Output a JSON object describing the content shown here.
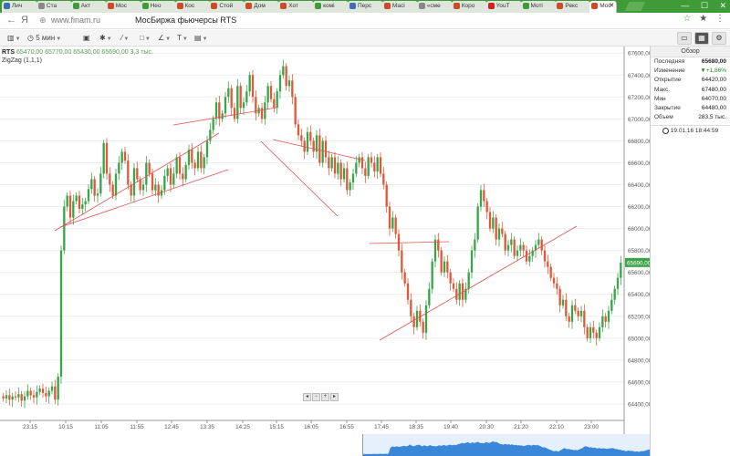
{
  "browser": {
    "tabs": [
      {
        "label": "Лич",
        "icon_color": "#3d6fb4"
      },
      {
        "label": "Ста",
        "icon_color": "#888888"
      },
      {
        "label": "Акт",
        "icon_color": "#3f9a38"
      },
      {
        "label": "Мос",
        "icon_color": "#d04a2a"
      },
      {
        "label": "Нео",
        "icon_color": "#3f9a38"
      },
      {
        "label": "Кос",
        "icon_color": "#d04a2a"
      },
      {
        "label": "Стой",
        "icon_color": "#d04a2a"
      },
      {
        "label": "Дом",
        "icon_color": "#d04a2a"
      },
      {
        "label": "Хот",
        "icon_color": "#d04a2a"
      },
      {
        "label": "комі",
        "icon_color": "#3f9a38"
      },
      {
        "label": "Перс",
        "icon_color": "#3d6fb4"
      },
      {
        "label": "Масі",
        "icon_color": "#d04a2a"
      },
      {
        "label": "«сме",
        "icon_color": "#888888"
      },
      {
        "label": "Коро",
        "icon_color": "#d04a2a"
      },
      {
        "label": "YouT",
        "icon_color": "#d02020"
      },
      {
        "label": "Моті",
        "icon_color": "#3f9a38"
      },
      {
        "label": "Рекс",
        "icon_color": "#d04a2a"
      },
      {
        "label": "Мос",
        "icon_color": "#d04a2a",
        "active": true
      }
    ],
    "window_controls": [
      "—",
      "☐",
      "✕"
    ],
    "back_icon": "←",
    "forward_icon": "Я",
    "url": "www.finam.ru",
    "page_title": "МосБиржа фьючерсы RTS",
    "addr_icons": [
      "☆",
      "★",
      "⋮"
    ]
  },
  "toolbar": {
    "interval": "5 мин",
    "items": [
      "chart-type",
      "interval",
      "save",
      "indicators",
      "draw",
      "shapes",
      "lines",
      "text",
      "image"
    ]
  },
  "legend": {
    "symbol": "RTS",
    "ohlc": "65470,00  65770,00  65430,00  65690,00  3,3 тыс.",
    "indicator": "ZigZag (1,1,1)"
  },
  "chart_data": {
    "type": "candlestick",
    "symbol": "RTS",
    "y_ticks": [
      64400,
      64600,
      64800,
      65000,
      65200,
      65400,
      65600,
      65800,
      66000,
      66200,
      66400,
      66600,
      66800,
      67000,
      67200,
      67400,
      67600
    ],
    "y_tick_labels": [
      "64400,00",
      "64600,00",
      "64800,00",
      "65000,00",
      "65200,00",
      "65400,00",
      "65600,00",
      "65800,00",
      "66000,00",
      "66200,00",
      "66400,00",
      "66600,00",
      "66800,00",
      "67000,00",
      "67200,00",
      "67400,00",
      "67600,00"
    ],
    "ylim": [
      64250,
      67660
    ],
    "x_labels": [
      "23:15",
      "10:15",
      "11:05",
      "11:55",
      "12:45",
      "13:35",
      "14:25",
      "15:15",
      "16:05",
      "16:55",
      "17:45",
      "18:35",
      "19:40",
      "20:30",
      "21:20",
      "22:10",
      "23:00"
    ],
    "last_price": "65690,00",
    "up_color": "#3aa54a",
    "down_color": "#e05a3a",
    "line_color": "#e05050",
    "closes": [
      64450,
      64480,
      64440,
      64470,
      64460,
      64490,
      64430,
      64470,
      64520,
      64480,
      64460,
      64510,
      64540,
      64500,
      64470,
      64520,
      64560,
      64440,
      64650,
      65800,
      66200,
      66300,
      66100,
      66250,
      66300,
      66180,
      66220,
      66250,
      66360,
      66450,
      66300,
      66320,
      66500,
      66780,
      66500,
      66400,
      66300,
      66500,
      66600,
      66700,
      66620,
      66400,
      66300,
      66550,
      66450,
      66350,
      66400,
      66600,
      66500,
      66350,
      66400,
      66300,
      66350,
      66480,
      66550,
      66400,
      66500,
      66650,
      66500,
      66450,
      66580,
      66720,
      66600,
      66550,
      66700,
      66550,
      66650,
      66800,
      66900,
      67000,
      67150,
      67000,
      67050,
      67200,
      67280,
      67100,
      67000,
      67300,
      67100,
      67150,
      67250,
      67400,
      67200,
      67050,
      67100,
      67000,
      67150,
      67300,
      67180,
      67100,
      67250,
      67400,
      67480,
      67300,
      67350,
      67200,
      66950,
      66850,
      66800,
      66700,
      66880,
      66800,
      66700,
      66850,
      66600,
      66800,
      66650,
      66550,
      66650,
      66500,
      66600,
      66450,
      66550,
      66350,
      66420,
      66500,
      66600,
      66650,
      66550,
      66480,
      66650,
      66600,
      66520,
      66650,
      66500,
      66400,
      66200,
      66000,
      66100,
      65950,
      65800,
      65600,
      65500,
      65350,
      65200,
      65100,
      65250,
      65150,
      65050,
      65300,
      65450,
      65700,
      65900,
      65800,
      65600,
      65700,
      65600,
      65500,
      65450,
      65350,
      65500,
      65350,
      65450,
      65600,
      65800,
      65900,
      66200,
      66350,
      66250,
      66150,
      66000,
      66100,
      65900,
      66000,
      65950,
      65800,
      65850,
      65900,
      65750,
      65800,
      65850,
      65800,
      65700,
      65750,
      65800,
      65850,
      65900,
      65800,
      65700,
      65650,
      65550,
      65500,
      65450,
      65300,
      65350,
      65200,
      65150,
      65300,
      65250,
      65200,
      65250,
      65100,
      65000,
      65100,
      65050,
      65000,
      65100,
      65200,
      65150,
      65250,
      65350,
      65450,
      65550,
      65690
    ]
  },
  "navigator": {
    "color": "#3a86d8"
  },
  "panel": {
    "title": "Обзор",
    "rows": [
      {
        "label": "Последняя",
        "value": "65680,00",
        "bold": true
      },
      {
        "label": "Изменение",
        "value": "▼+1,86%",
        "up": true
      },
      {
        "label": "Открытие",
        "value": "64420,00"
      },
      {
        "label": "Макс.",
        "value": "67480,00"
      },
      {
        "label": "Мин",
        "value": "64070,00"
      },
      {
        "label": "Закрытие",
        "value": "64480,00"
      },
      {
        "label": "Объем",
        "value": "283,5 тыс."
      }
    ],
    "time": "19.01.16 18:44:59"
  }
}
